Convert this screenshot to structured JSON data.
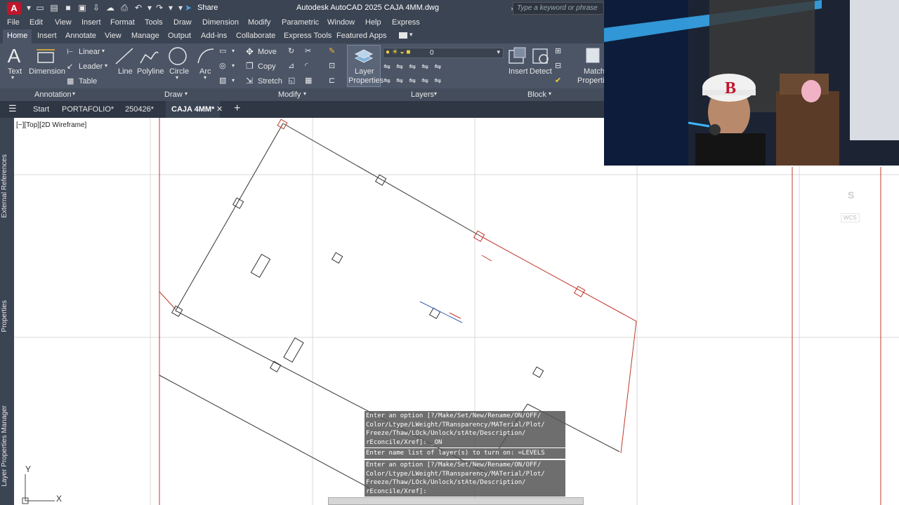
{
  "window": {
    "logo": "A",
    "title": "Autodesk AutoCAD 2025    CAJA 4MM.dwg",
    "share_label": "Share",
    "search_placeholder": "Type a keyword or phrase"
  },
  "menu": [
    "File",
    "Edit",
    "View",
    "Insert",
    "Format",
    "Tools",
    "Draw",
    "Dimension",
    "Modify",
    "Parametric",
    "Window",
    "Help",
    "Express"
  ],
  "ribbon_tabs": [
    "Home",
    "Insert",
    "Annotate",
    "View",
    "Manage",
    "Output",
    "Add-ins",
    "Collaborate",
    "Express Tools",
    "Featured Apps"
  ],
  "ribbon": {
    "annotation": {
      "text": "Text",
      "dimension": "Dimension",
      "linear": "Linear",
      "leader": "Leader",
      "table": "Table",
      "panel_title": "Annotation"
    },
    "draw": {
      "line": "Line",
      "polyline": "Polyline",
      "circle": "Circle",
      "arc": "Arc",
      "panel_title": "Draw"
    },
    "modify": {
      "move": "Move",
      "copy": "Copy",
      "stretch": "Stretch",
      "panel_title": "Modify"
    },
    "layers": {
      "layer_properties_1": "Layer",
      "layer_properties_2": "Properties",
      "current_layer": "0",
      "panel_title": "Layers"
    },
    "block": {
      "insert": "Insert",
      "detect": "Detect",
      "panel_title": "Block"
    },
    "properties": {
      "match_1": "Match",
      "match_2": "Properties"
    }
  },
  "doc_tabs": [
    "Start",
    "PORTAFOLIO*",
    "250426*",
    "CAJA 4MM*"
  ],
  "viewport_label": "[−][Top][2D Wireframe]",
  "palettes": [
    "External References",
    "Properties",
    "Layer Properties Manager"
  ],
  "command_history": [
    "Enter an option [?/Make/Set/New/Rename/ON/OFF/\nColor/Ltype/LWeight/TRansparency/MATerial/Plot/\nFreeze/Thaw/LOck/Unlock/stAte/Description/\nrEconcile/Xref]: _ON",
    "Enter name list of layer(s) to turn on: =LEVELS",
    "Enter an option [?/Make/Set/New/Rename/ON/OFF/\nColor/Ltype/LWeight/TRansparency/MATerial/Plot/\nFreeze/Thaw/LOck/Unlock/stAte/Description/\nrEconcile/Xref]:"
  ],
  "ucs": {
    "y": "Y",
    "x": "X"
  },
  "viewcube": {
    "compass": "S",
    "wcs": "WCS"
  },
  "colors": {
    "accent_red": "#c0162c",
    "ribbon_bg": "#4b5566",
    "title_bg": "#3b4453"
  }
}
